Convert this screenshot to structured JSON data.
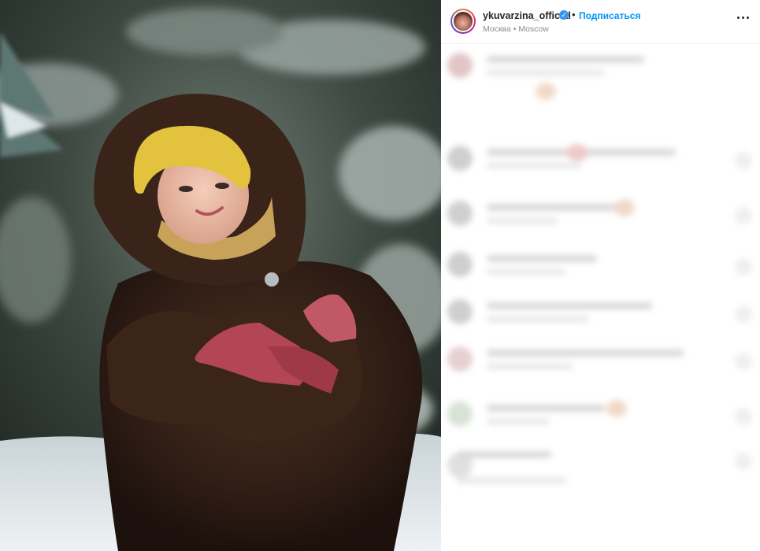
{
  "post": {
    "username": "ykuvarzina_official",
    "verified_icon": "verified-badge-icon",
    "separator": "•",
    "follow_label": "Подписаться",
    "location": "Москва • Moscow",
    "more_icon": "more-options-icon"
  },
  "colors": {
    "follow": "#0095f6",
    "verified": "#3897f0",
    "text": "#262626",
    "muted": "#8e8e8e"
  }
}
